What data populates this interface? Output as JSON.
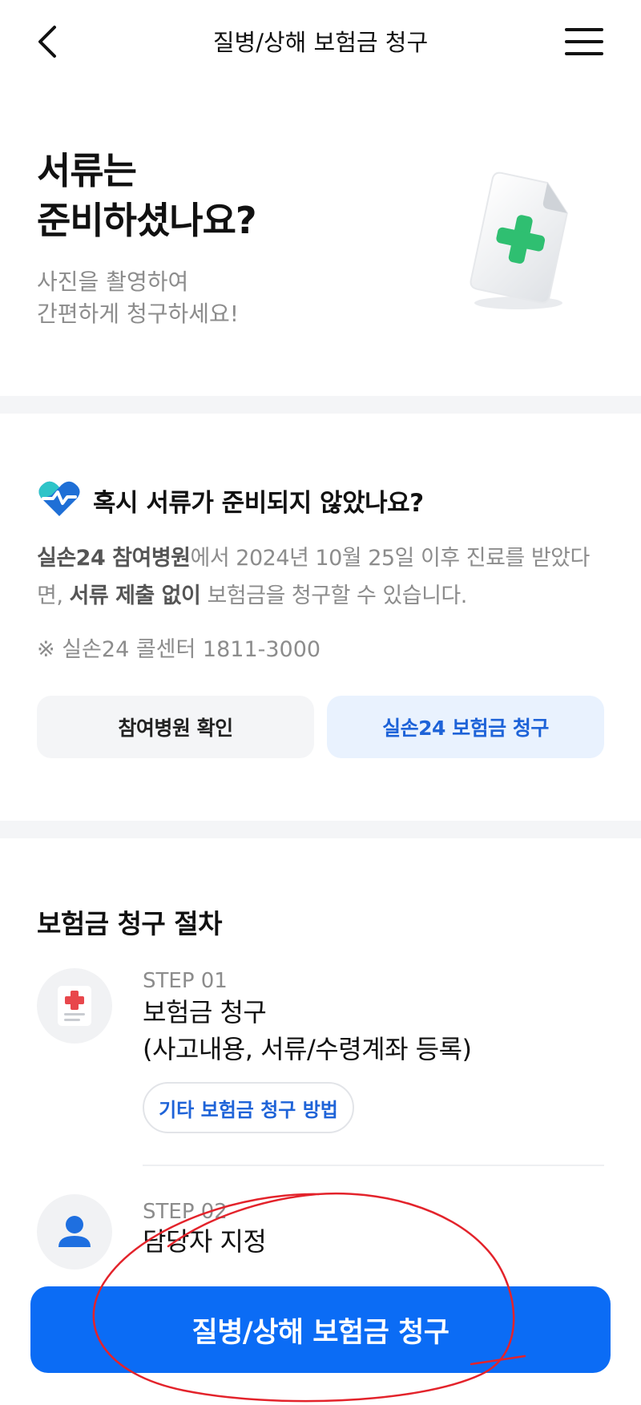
{
  "header": {
    "title": "질병/상해 보험금 청구"
  },
  "hero": {
    "title_line1": "서류는",
    "title_line2": "준비하셨나요?",
    "sub_line1": "사진을 촬영하여",
    "sub_line2": "간편하게 청구하세요!"
  },
  "notice": {
    "title": "혹시 서류가 준비되지 않았나요?",
    "body_bold1": "실손24 참여병원",
    "body_text1": "에서 2024년 10월 25일 이후 진료를 받았다면, ",
    "body_bold2": "서류 제출 없이",
    "body_text2": " 보험금을 청구할 수 있습니다.",
    "call_center": "※ 실손24 콜센터 1811-3000",
    "btn_hospital": "참여병원 확인",
    "btn_claim24": "실손24 보험금 청구"
  },
  "procedure": {
    "title": "보험금 청구 절차",
    "steps": [
      {
        "label": "STEP 01",
        "title_line1": "보험금 청구",
        "title_line2": "(사고내용, 서류/수령계좌 등록)",
        "chip": "기타 보험금 청구 방법"
      },
      {
        "label": "STEP 02",
        "title_line1": "담당자 지정"
      }
    ]
  },
  "cta": {
    "label": "질병/상해 보험금 청구"
  },
  "colors": {
    "primary": "#0b6cf5",
    "link_blue": "#1e63d8",
    "green_cross": "#2fbf71",
    "red_cross": "#e8474c",
    "annotation_red": "#e3232b"
  }
}
